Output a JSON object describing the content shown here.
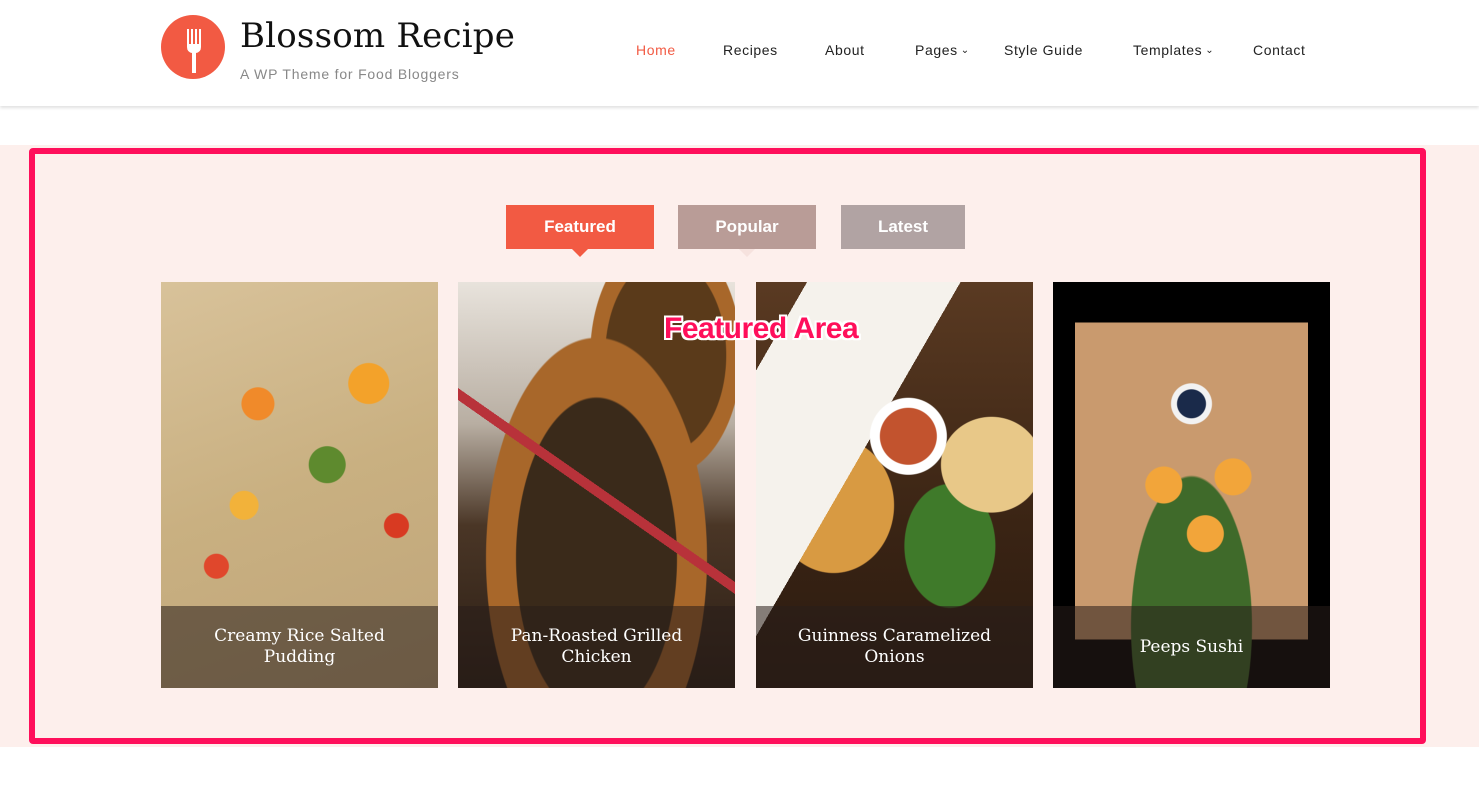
{
  "header": {
    "site_title": "Blossom Recipe",
    "tagline": "A WP Theme for Food Bloggers",
    "logo_icon": "fork-icon",
    "nav": [
      {
        "label": "Home",
        "active": true,
        "dropdown": false
      },
      {
        "label": "Recipes",
        "active": false,
        "dropdown": false
      },
      {
        "label": "About",
        "active": false,
        "dropdown": false
      },
      {
        "label": "Pages",
        "active": false,
        "dropdown": true
      },
      {
        "label": "Style Guide",
        "active": false,
        "dropdown": false
      },
      {
        "label": "Templates",
        "active": false,
        "dropdown": true
      },
      {
        "label": "Contact",
        "active": false,
        "dropdown": false
      }
    ],
    "dropdown_glyph": "⌄"
  },
  "featured": {
    "annotation": "Featured Area",
    "tabs": [
      {
        "label": "Featured",
        "active": true,
        "color": "#f25a43"
      },
      {
        "label": "Popular",
        "active": false,
        "color": "#b99c97"
      },
      {
        "label": "Latest",
        "active": false,
        "color": "#b1a3a3"
      }
    ],
    "cards": [
      {
        "title": "Creamy Rice Salted Pudding"
      },
      {
        "title": "Pan-Roasted Grilled Chicken"
      },
      {
        "title": "Guinness Caramelized Onions"
      },
      {
        "title": "Peeps Sushi"
      }
    ]
  },
  "colors": {
    "accent": "#f25a43",
    "highlight_frame": "#ff0f5b",
    "section_bg": "#fdefec"
  }
}
